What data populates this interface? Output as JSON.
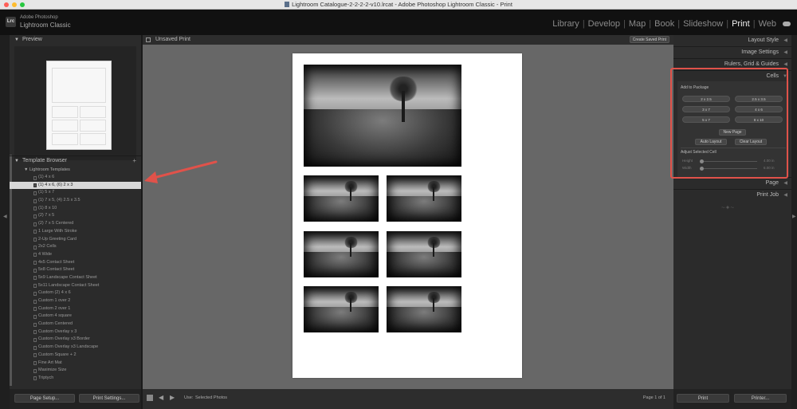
{
  "window": {
    "title": "Lightroom Catalogue-2-2-2-2-v10.lrcat - Adobe Photoshop Lightroom Classic - Print"
  },
  "identity": {
    "logo": "Lrc",
    "line1": "Adobe Photoshop",
    "line2": "Lightroom Classic"
  },
  "modules": [
    "Library",
    "Develop",
    "Map",
    "Book",
    "Slideshow",
    "Print",
    "Web"
  ],
  "active_module": "Print",
  "left_panel": {
    "preview_header": "Preview",
    "template_browser_header": "Template Browser",
    "template_folder": "Lightroom Templates",
    "templates": [
      "(1) 4 x 6",
      "(1) 4 x 6, (6) 2 x 3",
      "(1) 5 x 7",
      "(1) 7 x 5, (4) 2.5 x 3.5",
      "(1) 8 x 10",
      "(2) 7 x 5",
      "(2) 7 x 5 Centered",
      "1 Large With Stroke",
      "2-Up Greeting Card",
      "2x2 Cells",
      "4 Wide",
      "4x5 Contact Sheet",
      "5x8 Contact Sheet",
      "5x9 Landscape Contact Sheet",
      "5x11 Landscape Contact Sheet",
      "Custom (2) 4 x 6",
      "Custom 1 over 2",
      "Custom 2 over 1",
      "Custom 4 square",
      "Custom Centered",
      "Custom Overlay x 3",
      "Custom Overlay x3 Border",
      "Custom Overlay x3 Landscape",
      "Custom Square + 2",
      "Fine Art Mat",
      "Maximize Size",
      "Triptych"
    ],
    "selected_template": "(1) 4 x 6, (6) 2 x 3",
    "page_setup_button": "Page Setup...",
    "print_settings_button": "Print Settings..."
  },
  "center": {
    "title": "Unsaved Print",
    "create_saved_print": "Create Saved Print",
    "bottom_label": "Use:",
    "bottom_value": "Selected Photos",
    "page_indicator": "Page 1 of 1"
  },
  "right_panel": {
    "sections": [
      "Layout Style",
      "Image Settings",
      "Rulers, Grid & Guides",
      "Cells",
      "Page",
      "Print Job"
    ],
    "cells": {
      "add_to_package": "Add to Package",
      "size_buttons": [
        "2 x 2.5",
        "2.5 x 3.5",
        "3 x 7",
        "4 x 6",
        "5 x 7",
        "8 x 10"
      ],
      "new_page": "New Page",
      "auto_layout": "Auto Layout",
      "clear_layout": "Clear Layout",
      "adjust_selected_cell": "Adjust Selected Cell",
      "height_label": "Height",
      "width_label": "Width",
      "height_value": "4.00 in",
      "width_value": "6.00 in"
    },
    "print_button": "Print",
    "printer_button": "Printer..."
  },
  "colors": {
    "highlight": "#e0524a",
    "selected_row": "#d8d8d8",
    "canvas_bg": "#676767"
  }
}
